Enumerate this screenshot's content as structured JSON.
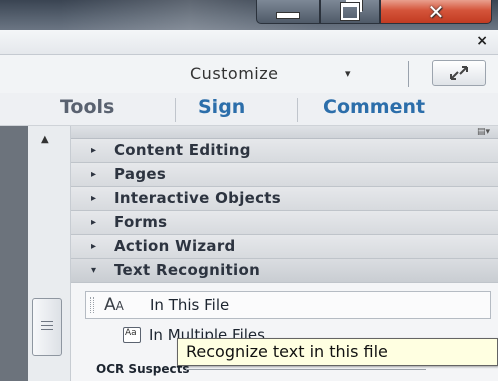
{
  "window": {
    "minimize_glyph": "—",
    "close_glyph": "✕"
  },
  "panel_close": "×",
  "toolbar": {
    "customize_label": "Customize",
    "customize_caret": "▾"
  },
  "tabs": [
    {
      "label": "Tools"
    },
    {
      "label": "Sign"
    },
    {
      "label": "Comment"
    }
  ],
  "sections": [
    {
      "label": "Content Editing",
      "arrow": "▸"
    },
    {
      "label": "Pages",
      "arrow": "▸"
    },
    {
      "label": "Interactive Objects",
      "arrow": "▸"
    },
    {
      "label": "Forms",
      "arrow": "▸"
    },
    {
      "label": "Action Wizard",
      "arrow": "▸"
    },
    {
      "label": "Text Recognition",
      "arrow": "▾"
    }
  ],
  "text_recognition_items": [
    {
      "label": "In This File",
      "icon": "text-recognition-icon"
    },
    {
      "label": "In Multiple Files",
      "icon": "multiple-files-icon"
    }
  ],
  "tooltip": "Recognize text in this file",
  "ocr_suspects_label": "OCR Suspects",
  "colors": {
    "tab_active": "#2c6eaa",
    "tooltip_bg": "#ffffe1",
    "close_red": "#c23b22"
  }
}
